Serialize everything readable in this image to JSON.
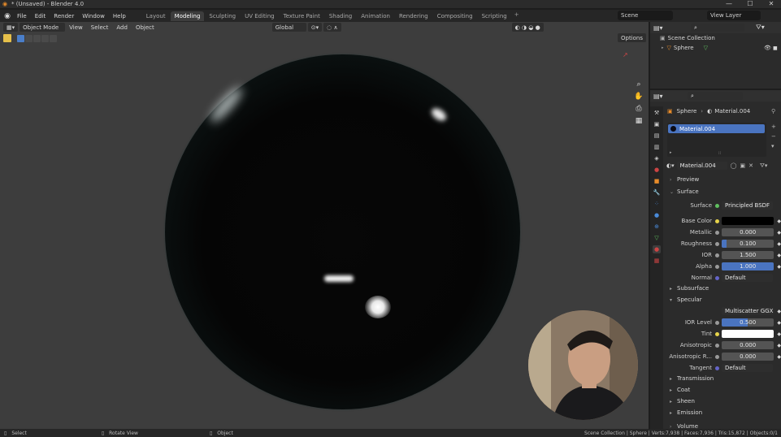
{
  "window": {
    "title": "* (Unsaved) - Blender 4.0",
    "controls": [
      "—",
      "☐",
      "✕"
    ]
  },
  "menu": {
    "items": [
      "File",
      "Edit",
      "Render",
      "Window",
      "Help"
    ],
    "workspace_tabs": [
      "Layout",
      "Modeling",
      "Sculpting",
      "UV Editing",
      "Texture Paint",
      "Shading",
      "Animation",
      "Rendering",
      "Compositing",
      "Scripting"
    ],
    "active_tab": "Modeling",
    "add_tab": "+",
    "scene": "Scene",
    "view_layer": "View Layer"
  },
  "viewport": {
    "mode": "Object Mode",
    "menus": [
      "View",
      "Select",
      "Add",
      "Object"
    ],
    "orientation": "Global",
    "options": "Options"
  },
  "outliner": {
    "root": "Scene Collection",
    "object": "Sphere"
  },
  "properties": {
    "breadcrumb_object": "Sphere",
    "breadcrumb_material": "Material.004",
    "slot": "Material.004",
    "material_name": "Material.004",
    "sections": {
      "preview": "Preview",
      "surface": "Surface",
      "subsurface": "Subsurface",
      "specular": "Specular",
      "transmission": "Transmission",
      "coat": "Coat",
      "sheen": "Sheen",
      "emission": "Emission",
      "volume": "Volume"
    },
    "fields": {
      "surface_label": "Surface",
      "surface_value": "Principled BSDF",
      "base_color_label": "Base Color",
      "metallic_label": "Metallic",
      "metallic_value": "0.000",
      "roughness_label": "Roughness",
      "roughness_value": "0.100",
      "ior_label": "IOR",
      "ior_value": "1.500",
      "alpha_label": "Alpha",
      "alpha_value": "1.000",
      "normal_label": "Normal",
      "normal_value": "Default",
      "distribution_value": "Multiscatter GGX",
      "ior_level_label": "IOR Level",
      "ior_level_value": "0.500",
      "tint_label": "Tint",
      "anisotropic_label": "Anisotropic",
      "anisotropic_value": "0.000",
      "anisotropic_rot_label": "Anisotropic R...",
      "anisotropic_rot_value": "0.000",
      "tangent_label": "Tangent",
      "tangent_value": "Default"
    },
    "fills": {
      "metallic": 0.0,
      "roughness": 0.1,
      "alpha": 1.0,
      "ior_level": 0.5
    },
    "colors": {
      "base_color": "#000000",
      "tint": "#ffffff",
      "accent": "#4a74c0"
    }
  },
  "status": {
    "left": [
      "Select",
      "Rotate View",
      "Object"
    ],
    "right": "Scene Collection | Sphere | Verts:7,938 | Faces:7,936 | Tris:15,872 | Objects:0/1"
  },
  "icons": [
    "blender-logo-icon",
    "search-icon",
    "hand-icon",
    "camera-icon",
    "grid-icon",
    "material-sphere-icon",
    "eye-icon",
    "filter-icon"
  ]
}
